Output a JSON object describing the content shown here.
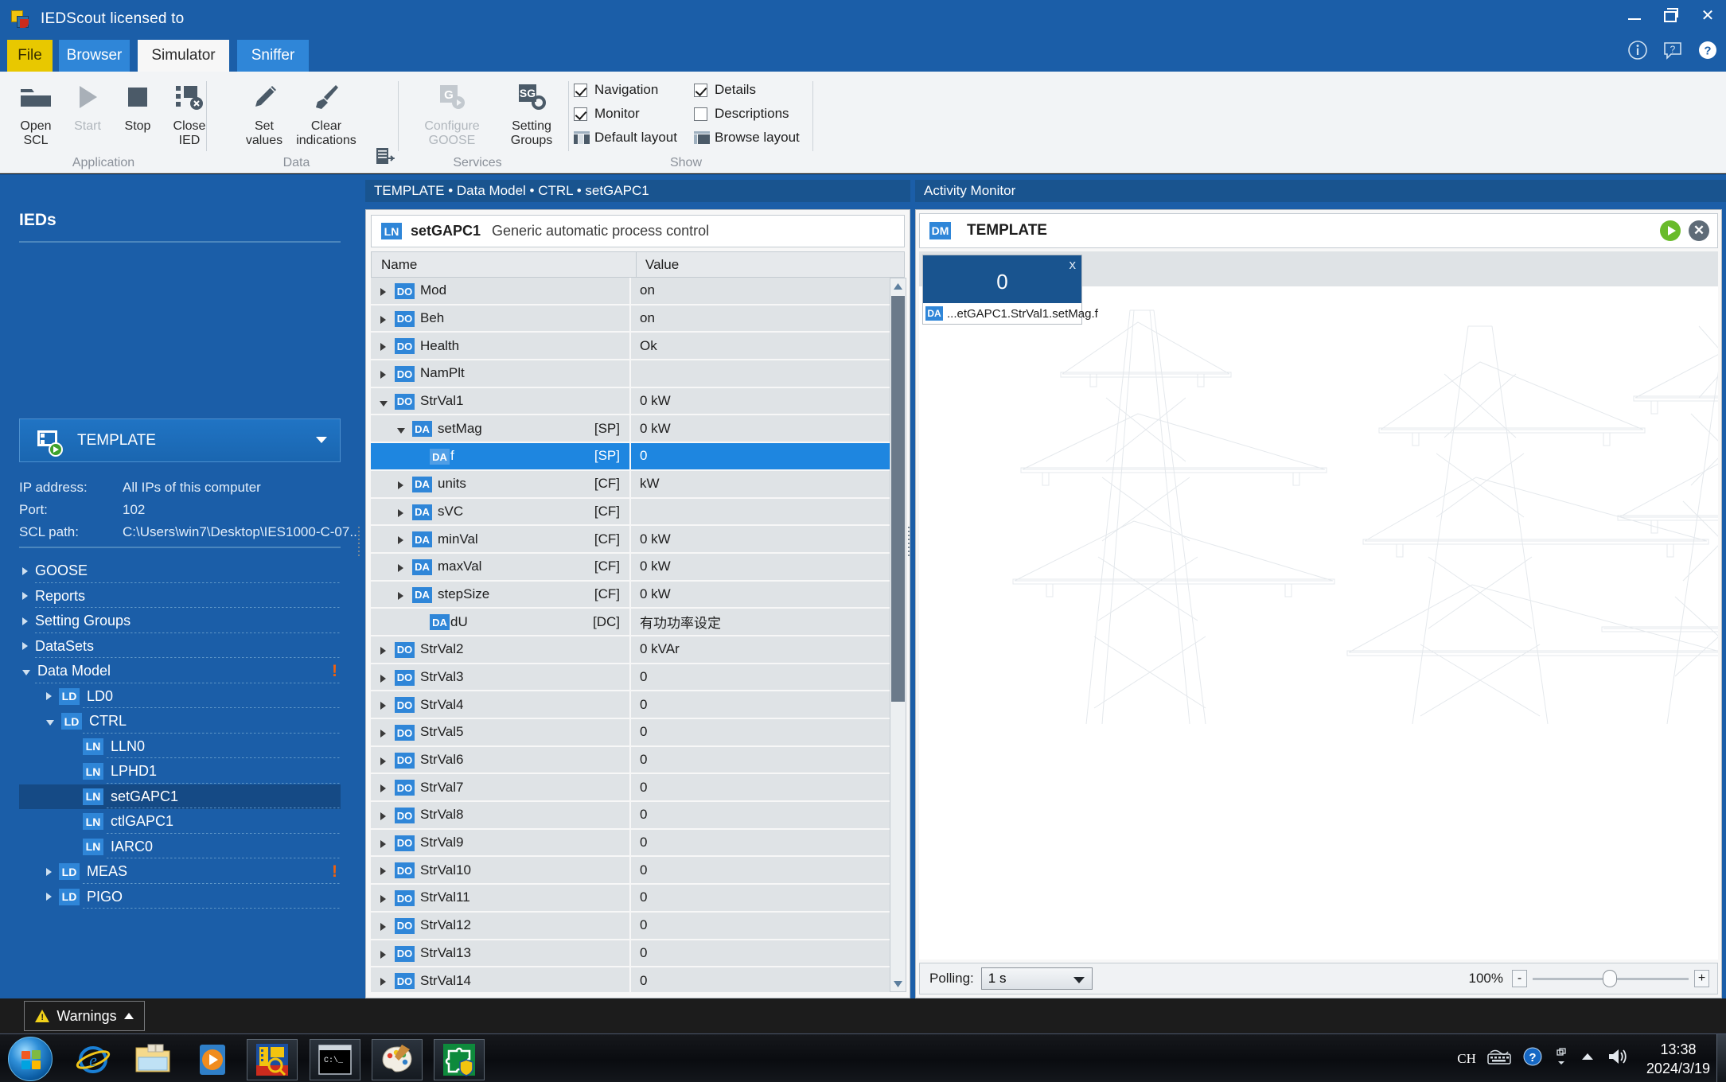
{
  "window": {
    "title": "IEDScout licensed to",
    "app_icon": "iedscout-logo-icon",
    "minimize": "–",
    "restore": "restore-icon",
    "close": "✕"
  },
  "tabs": [
    {
      "label": "File",
      "key": "file"
    },
    {
      "label": "Browser",
      "key": "browser"
    },
    {
      "label": "Simulator",
      "key": "simulator"
    },
    {
      "label": "Sniffer",
      "key": "sniffer"
    }
  ],
  "help_icons": [
    "info-icon",
    "whats-this-icon",
    "help-icon"
  ],
  "ribbon": {
    "groups": [
      {
        "label": "Application"
      },
      {
        "label": "Data"
      },
      {
        "label": "Services"
      },
      {
        "label": "Show"
      }
    ],
    "buttons": {
      "open_scl": "Open\nSCL",
      "open_scl_l1": "Open",
      "open_scl_l2": "SCL",
      "start": "Start",
      "stop": "Stop",
      "close_ied_l1": "Close",
      "close_ied_l2": "IED",
      "set_values_l1": "Set",
      "set_values_l2": "values",
      "clear_ind_l1": "Clear",
      "clear_ind_l2": "indications",
      "configure_goose_l1": "Configure",
      "configure_goose_l2": "GOOSE",
      "setting_groups_l1": "Setting",
      "setting_groups_l2": "Groups"
    },
    "checkboxes": [
      {
        "label": "Navigation",
        "checked": true
      },
      {
        "label": "Monitor",
        "checked": true
      },
      {
        "label": "Details",
        "checked": true
      },
      {
        "label": "Descriptions",
        "checked": false
      }
    ],
    "layout_buttons": [
      {
        "label": "Default layout"
      },
      {
        "label": "Browse layout"
      }
    ]
  },
  "left_panel": {
    "title": "IEDs",
    "selected_ied": "TEMPLATE",
    "meta": [
      {
        "key": "IP address:",
        "value": "All IPs of this computer"
      },
      {
        "key": "Port:",
        "value": "102"
      },
      {
        "key": "SCL path:",
        "value": "C:\\Users\\win7\\Desktop\\IES1000-C-07..."
      }
    ],
    "tree": [
      {
        "label": "GOOSE",
        "indent": 0,
        "arrow": "closed",
        "badge": "",
        "warn": false,
        "selected": false
      },
      {
        "label": "Reports",
        "indent": 0,
        "arrow": "closed",
        "badge": "",
        "warn": false,
        "selected": false
      },
      {
        "label": "Setting Groups",
        "indent": 0,
        "arrow": "closed",
        "badge": "",
        "warn": false,
        "selected": false
      },
      {
        "label": "DataSets",
        "indent": 0,
        "arrow": "closed",
        "badge": "",
        "warn": false,
        "selected": false
      },
      {
        "label": "Data Model",
        "indent": 0,
        "arrow": "open",
        "badge": "",
        "warn": true,
        "selected": false
      },
      {
        "label": "LD0",
        "indent": 1,
        "arrow": "closed",
        "badge": "LD",
        "warn": false,
        "selected": false
      },
      {
        "label": "CTRL",
        "indent": 1,
        "arrow": "open",
        "badge": "LD",
        "warn": false,
        "selected": false
      },
      {
        "label": "LLN0",
        "indent": 2,
        "arrow": "none",
        "badge": "LN",
        "warn": false,
        "selected": false
      },
      {
        "label": "LPHD1",
        "indent": 2,
        "arrow": "none",
        "badge": "LN",
        "warn": false,
        "selected": false
      },
      {
        "label": "setGAPC1",
        "indent": 2,
        "arrow": "none",
        "badge": "LN",
        "warn": false,
        "selected": true
      },
      {
        "label": "ctlGAPC1",
        "indent": 2,
        "arrow": "none",
        "badge": "LN",
        "warn": false,
        "selected": false
      },
      {
        "label": "IARC0",
        "indent": 2,
        "arrow": "none",
        "badge": "LN",
        "warn": false,
        "selected": false
      },
      {
        "label": "MEAS",
        "indent": 1,
        "arrow": "closed",
        "badge": "LD",
        "warn": true,
        "selected": false
      },
      {
        "label": "PIGO",
        "indent": 1,
        "arrow": "closed",
        "badge": "LD",
        "warn": false,
        "selected": false
      }
    ]
  },
  "center_panel": {
    "breadcrumb": "TEMPLATE • Data Model • CTRL • setGAPC1",
    "ln_badge": "LN",
    "ln_name": "setGAPC1",
    "ln_description": "Generic automatic process control",
    "columns": [
      "Name",
      "Value"
    ],
    "rows": [
      {
        "badge": "DO",
        "name": "Mod",
        "fc": "",
        "value": "on",
        "indent": 0,
        "arrow": "closed",
        "selected": false
      },
      {
        "badge": "DO",
        "name": "Beh",
        "fc": "",
        "value": "on",
        "indent": 0,
        "arrow": "closed",
        "selected": false
      },
      {
        "badge": "DO",
        "name": "Health",
        "fc": "",
        "value": "Ok",
        "indent": 0,
        "arrow": "closed",
        "selected": false
      },
      {
        "badge": "DO",
        "name": "NamPlt",
        "fc": "",
        "value": "",
        "indent": 0,
        "arrow": "closed",
        "selected": false
      },
      {
        "badge": "DO",
        "name": "StrVal1",
        "fc": "",
        "value": "0 kW",
        "indent": 0,
        "arrow": "open",
        "selected": false
      },
      {
        "badge": "DA",
        "name": "setMag",
        "fc": "[SP]",
        "value": "0 kW",
        "indent": 1,
        "arrow": "open",
        "selected": false
      },
      {
        "badge": "DA",
        "name": "f",
        "fc": "[SP]",
        "value": "0",
        "indent": 2,
        "arrow": "none",
        "selected": true
      },
      {
        "badge": "DA",
        "name": "units",
        "fc": "[CF]",
        "value": "kW",
        "indent": 1,
        "arrow": "closed",
        "selected": false
      },
      {
        "badge": "DA",
        "name": "sVC",
        "fc": "[CF]",
        "value": "",
        "indent": 1,
        "arrow": "closed",
        "selected": false
      },
      {
        "badge": "DA",
        "name": "minVal",
        "fc": "[CF]",
        "value": "0 kW",
        "indent": 1,
        "arrow": "closed",
        "selected": false
      },
      {
        "badge": "DA",
        "name": "maxVal",
        "fc": "[CF]",
        "value": "0 kW",
        "indent": 1,
        "arrow": "closed",
        "selected": false
      },
      {
        "badge": "DA",
        "name": "stepSize",
        "fc": "[CF]",
        "value": "0 kW",
        "indent": 1,
        "arrow": "closed",
        "selected": false
      },
      {
        "badge": "DA",
        "name": "dU",
        "fc": "[DC]",
        "value": "有功功率设定",
        "indent": 2,
        "arrow": "none",
        "selected": false
      },
      {
        "badge": "DO",
        "name": "StrVal2",
        "fc": "",
        "value": "0 kVAr",
        "indent": 0,
        "arrow": "closed",
        "selected": false
      },
      {
        "badge": "DO",
        "name": "StrVal3",
        "fc": "",
        "value": "0",
        "indent": 0,
        "arrow": "closed",
        "selected": false
      },
      {
        "badge": "DO",
        "name": "StrVal4",
        "fc": "",
        "value": "0",
        "indent": 0,
        "arrow": "closed",
        "selected": false
      },
      {
        "badge": "DO",
        "name": "StrVal5",
        "fc": "",
        "value": "0",
        "indent": 0,
        "arrow": "closed",
        "selected": false
      },
      {
        "badge": "DO",
        "name": "StrVal6",
        "fc": "",
        "value": "0",
        "indent": 0,
        "arrow": "closed",
        "selected": false
      },
      {
        "badge": "DO",
        "name": "StrVal7",
        "fc": "",
        "value": "0",
        "indent": 0,
        "arrow": "closed",
        "selected": false
      },
      {
        "badge": "DO",
        "name": "StrVal8",
        "fc": "",
        "value": "0",
        "indent": 0,
        "arrow": "closed",
        "selected": false
      },
      {
        "badge": "DO",
        "name": "StrVal9",
        "fc": "",
        "value": "0",
        "indent": 0,
        "arrow": "closed",
        "selected": false
      },
      {
        "badge": "DO",
        "name": "StrVal10",
        "fc": "",
        "value": "0",
        "indent": 0,
        "arrow": "closed",
        "selected": false
      },
      {
        "badge": "DO",
        "name": "StrVal11",
        "fc": "",
        "value": "0",
        "indent": 0,
        "arrow": "closed",
        "selected": false
      },
      {
        "badge": "DO",
        "name": "StrVal12",
        "fc": "",
        "value": "0",
        "indent": 0,
        "arrow": "closed",
        "selected": false
      },
      {
        "badge": "DO",
        "name": "StrVal13",
        "fc": "",
        "value": "0",
        "indent": 0,
        "arrow": "closed",
        "selected": false
      },
      {
        "badge": "DO",
        "name": "StrVal14",
        "fc": "",
        "value": "0",
        "indent": 0,
        "arrow": "closed",
        "selected": false
      }
    ]
  },
  "right_panel": {
    "title": "Activity Monitor",
    "dm_badge": "DM",
    "dm_name": "TEMPLATE",
    "play_icon": "play-icon",
    "close_icon": "✕",
    "tile": {
      "value": "0",
      "close": "x",
      "badge": "DA",
      "path": "...etGAPC1.StrVal1.setMag.f"
    },
    "footer": {
      "polling_label": "Polling:",
      "polling_value": "1 s",
      "zoom_percent": "100%",
      "zoom_out": "-",
      "zoom_in": "+"
    }
  },
  "warnings": {
    "label": "Warnings",
    "icon": "warning-triangle-icon",
    "caret": "chevron-up-icon"
  },
  "taskbar": {
    "items": [
      {
        "name": "start-orb",
        "framed": false
      },
      {
        "name": "internet-explorer-icon",
        "framed": false
      },
      {
        "name": "file-explorer-icon",
        "framed": false
      },
      {
        "name": "media-player-icon",
        "framed": false
      },
      {
        "name": "iedscout-icon",
        "framed": true
      },
      {
        "name": "command-prompt-icon",
        "framed": true
      },
      {
        "name": "paint-icon",
        "framed": true
      },
      {
        "name": "puzzle-app-icon",
        "framed": true
      }
    ],
    "tray": {
      "language": "CH",
      "time": "13:38",
      "date": "2024/3/19"
    }
  },
  "colors": {
    "accent_blue": "#1b5ea8",
    "tab_blue": "#2f86d8",
    "file_yellow": "#e8c800",
    "selection_blue": "#1e86e0",
    "warn_orange": "#f2610c",
    "green": "#69bb2b"
  }
}
